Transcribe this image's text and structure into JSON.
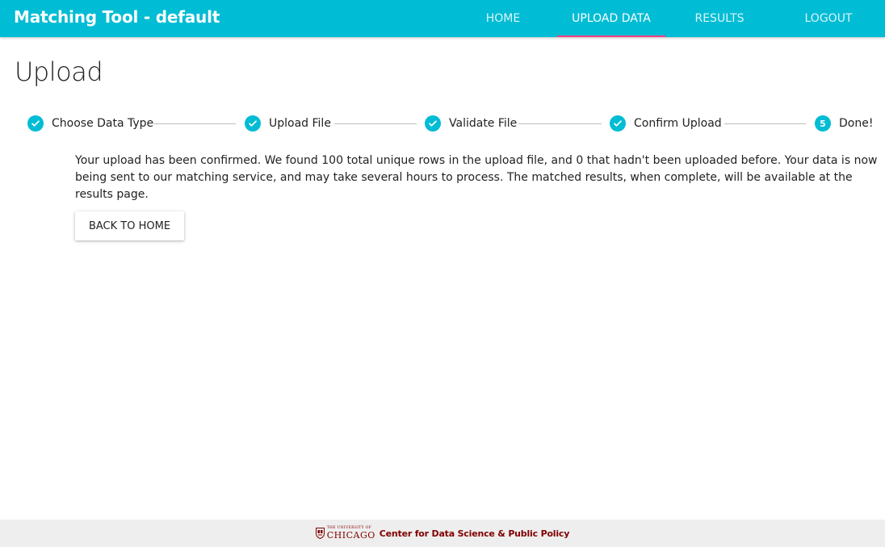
{
  "app": {
    "title": "Matching Tool - default",
    "accent_color": "#00bcd4",
    "tab_indicator_color": "#ff4081"
  },
  "nav": {
    "tabs": [
      {
        "label": "HOME",
        "active": false
      },
      {
        "label": "UPLOAD DATA",
        "active": true
      },
      {
        "label": "RESULTS",
        "active": false
      },
      {
        "label": "LOGOUT",
        "active": false
      }
    ]
  },
  "page": {
    "title": "Upload"
  },
  "stepper": {
    "steps": [
      {
        "label": "Choose Data Type",
        "status": "completed",
        "icon": "check-icon"
      },
      {
        "label": "Upload File",
        "status": "completed",
        "icon": "check-icon"
      },
      {
        "label": "Validate File",
        "status": "completed",
        "icon": "check-icon"
      },
      {
        "label": "Confirm Upload",
        "status": "completed",
        "icon": "check-icon"
      },
      {
        "label": "Done!",
        "status": "active",
        "number": "5"
      }
    ]
  },
  "content": {
    "message": "Your upload has been confirmed. We found 100 total unique rows in the upload file, and 0 that hadn't been uploaded before. Your data is now being sent to our matching service, and may take several hours to process. The matched results, when complete, will be available at the results page.",
    "back_button": "BACK TO HOME"
  },
  "footer": {
    "logo_small": "THE UNIVERSITY OF",
    "logo_big": "CHICAGO",
    "text": "Center for Data Science & Public Policy",
    "brand_color": "#800000"
  }
}
